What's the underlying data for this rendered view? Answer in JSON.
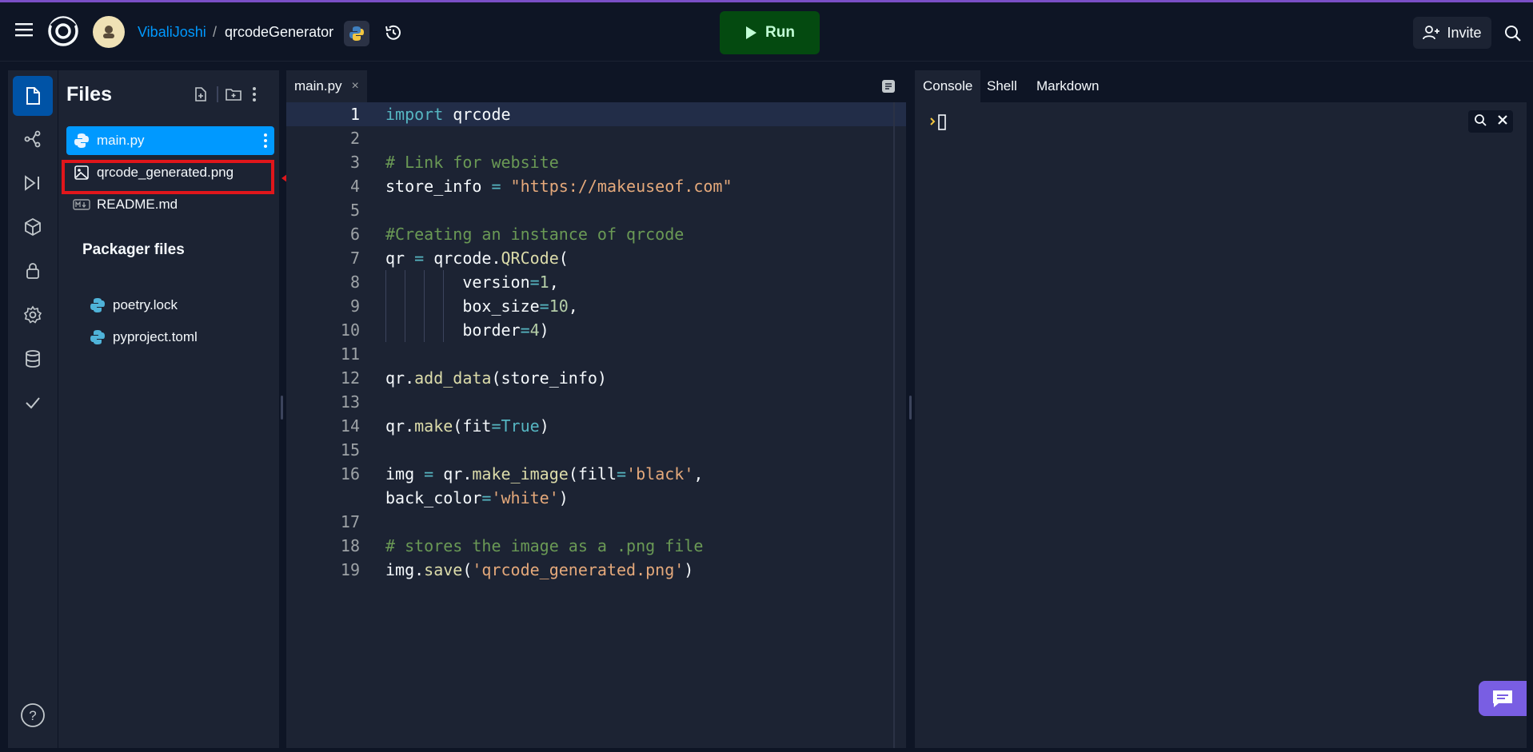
{
  "header": {
    "menu_icon": "hamburger-menu-icon",
    "user": "VibaliJoshi",
    "separator": "/",
    "repl_name": "qrcodeGenerator",
    "run_label": "Run",
    "invite_label": "Invite"
  },
  "files": {
    "title": "Files",
    "items": [
      {
        "label": "main.py",
        "icon": "python-icon"
      },
      {
        "label": "qrcode_generated.png",
        "icon": "image-icon"
      },
      {
        "label": "README.md",
        "icon": "markdown-icon"
      }
    ],
    "packager_title": "Packager files",
    "packager_items": [
      {
        "label": "poetry.lock",
        "icon": "python-icon"
      },
      {
        "label": "pyproject.toml",
        "icon": "python-icon"
      }
    ]
  },
  "editor": {
    "tab_label": "main.py",
    "tab_close": "×",
    "line_numbers": [
      "1",
      "2",
      "3",
      "4",
      "5",
      "6",
      "7",
      "8",
      "9",
      "10",
      "11",
      "12",
      "13",
      "14",
      "15",
      "16",
      "",
      "17",
      "18",
      "19"
    ]
  },
  "right": {
    "tabs": [
      "Console",
      "Shell",
      "Markdown"
    ]
  },
  "colors": {
    "accent": "#0099ff",
    "run_bg": "#044a10",
    "highlight": "#e0161b"
  }
}
